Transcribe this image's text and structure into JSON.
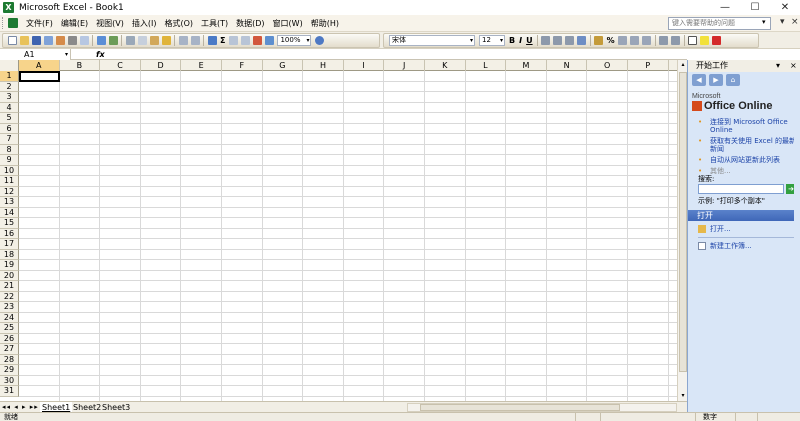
{
  "window": {
    "title": "Microsoft Excel - Book1",
    "app_icon": "X",
    "controls": [
      "—",
      "☐",
      "✕"
    ]
  },
  "menu": {
    "items": [
      "文件(F)",
      "编辑(E)",
      "视图(V)",
      "插入(I)",
      "格式(O)",
      "工具(T)",
      "数据(D)",
      "窗口(W)",
      "帮助(H)"
    ],
    "help_placeholder": "键入需要帮助的问题",
    "doc_controls": [
      "▾",
      "×"
    ]
  },
  "toolbar": {
    "zoom": "100%",
    "font_name": "宋体",
    "font_size": "12",
    "bold": "B",
    "italic": "I",
    "underline": "U",
    "percent": "%",
    "sum": "Σ"
  },
  "formula_bar": {
    "name_box": "A1",
    "fx": "fx",
    "value": ""
  },
  "grid": {
    "columns": [
      "A",
      "B",
      "C",
      "D",
      "E",
      "F",
      "G",
      "H",
      "I",
      "J",
      "K",
      "L",
      "M",
      "N",
      "O",
      "P"
    ],
    "rows": [
      "1",
      "2",
      "3",
      "4",
      "5",
      "6",
      "7",
      "8",
      "9",
      "10",
      "11",
      "12",
      "13",
      "14",
      "15",
      "16",
      "17",
      "18",
      "19",
      "20",
      "21",
      "22",
      "23",
      "24",
      "25",
      "26",
      "27",
      "28",
      "29",
      "30",
      "31"
    ],
    "active_cell": "A1",
    "selected_column": "A",
    "selected_row": "1"
  },
  "sheets": {
    "nav": "◂◂ ◂ ▸ ▸▸",
    "tabs": [
      "Sheet1",
      "Sheet2",
      "Sheet3"
    ],
    "active": "Sheet1"
  },
  "status": {
    "ready": "就绪",
    "mode": "数字"
  },
  "task_pane": {
    "title": "开始工作",
    "logo_small": "Microsoft",
    "logo_main": "Office Online",
    "links": [
      "连接到 Microsoft Office Online",
      "获取有关使用 Excel 的最新新闻",
      "自动从网站更新此列表"
    ],
    "more": "其他...",
    "search_label": "搜索:",
    "example": "示例: \"打印多个副本\"",
    "open_section": "打开",
    "open_item": "打开...",
    "new_item": "新建工作簿..."
  }
}
